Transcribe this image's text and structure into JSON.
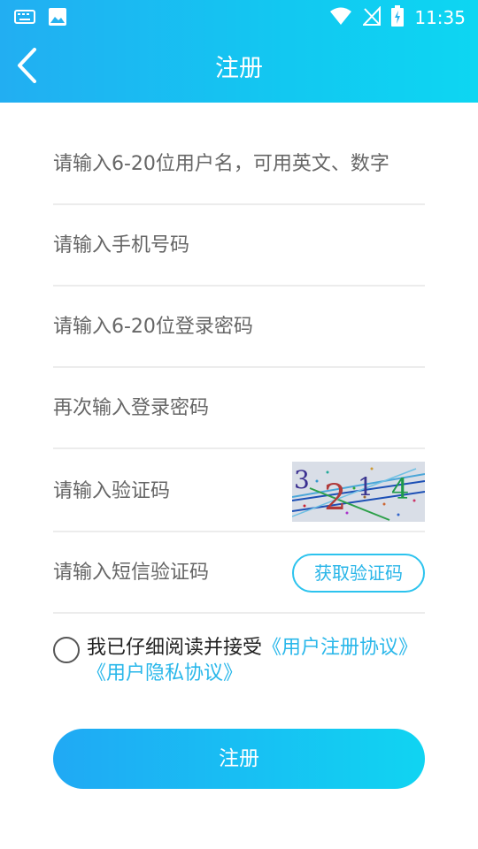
{
  "status_bar": {
    "time": "11:35",
    "left_icons": [
      "keyboard-icon",
      "image-icon"
    ],
    "right_icons": [
      "wifi-icon",
      "no-signal-icon",
      "battery-charging-icon"
    ]
  },
  "header": {
    "title": "注册",
    "back_icon": "chevron-left-icon"
  },
  "form": {
    "username_placeholder": "请输入6-20位用户名，可用英文、数字",
    "phone_placeholder": "请输入手机号码",
    "password_placeholder": "请输入6-20位登录密码",
    "confirm_password_placeholder": "再次输入登录密码",
    "captcha_placeholder": "请输入验证码",
    "captcha_digits": [
      "3",
      "2",
      "1",
      "4"
    ],
    "sms_placeholder": "请输入短信验证码",
    "sms_button": "获取验证码"
  },
  "agreement": {
    "prefix": "我已仔细阅读并接受",
    "user_agreement": "《用户注册协议》",
    "privacy_agreement": "《用户隐私协议》"
  },
  "submit_label": "注册",
  "colors": {
    "accent": "#22b4ef",
    "header_gradient_start": "#22aef2",
    "header_gradient_end": "#0dd6f2",
    "placeholder": "#666666",
    "divider": "#ececec"
  }
}
